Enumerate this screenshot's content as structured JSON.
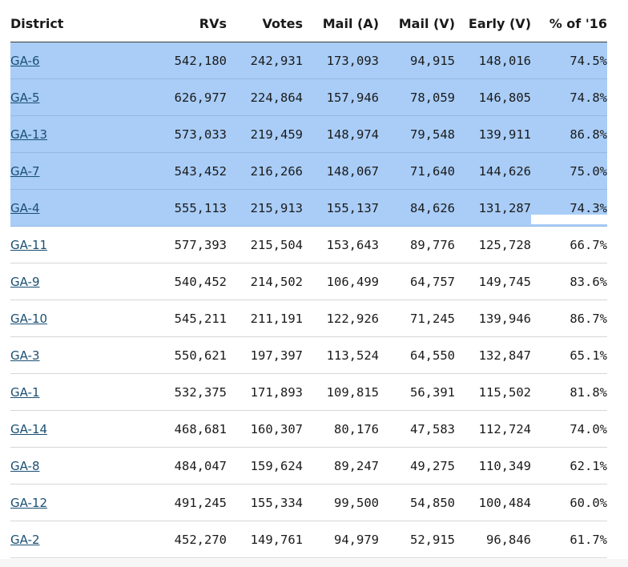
{
  "table": {
    "headers": {
      "district": "District",
      "rvs": "RVs",
      "votes": "Votes",
      "mail_a": "Mail (A)",
      "mail_v": "Mail (V)",
      "early_v": "Early (V)",
      "pct16": "% of '16"
    },
    "rows": [
      {
        "district": "GA-6",
        "rvs": "542,180",
        "votes": "242,931",
        "mail_a": "173,093",
        "mail_v": "94,915",
        "early_v": "148,016",
        "pct16": "74.5%",
        "selected": true
      },
      {
        "district": "GA-5",
        "rvs": "626,977",
        "votes": "224,864",
        "mail_a": "157,946",
        "mail_v": "78,059",
        "early_v": "146,805",
        "pct16": "74.8%",
        "selected": true
      },
      {
        "district": "GA-13",
        "rvs": "573,033",
        "votes": "219,459",
        "mail_a": "148,974",
        "mail_v": "79,548",
        "early_v": "139,911",
        "pct16": "86.8%",
        "selected": true
      },
      {
        "district": "GA-7",
        "rvs": "543,452",
        "votes": "216,266",
        "mail_a": "148,067",
        "mail_v": "71,640",
        "early_v": "144,626",
        "pct16": "75.0%",
        "selected": true
      },
      {
        "district": "GA-4",
        "rvs": "555,113",
        "votes": "215,913",
        "mail_a": "155,137",
        "mail_v": "84,626",
        "early_v": "131,287",
        "pct16": "74.3%",
        "selected": true
      },
      {
        "district": "GA-11",
        "rvs": "577,393",
        "votes": "215,504",
        "mail_a": "153,643",
        "mail_v": "89,776",
        "early_v": "125,728",
        "pct16": "66.7%",
        "selected": false
      },
      {
        "district": "GA-9",
        "rvs": "540,452",
        "votes": "214,502",
        "mail_a": "106,499",
        "mail_v": "64,757",
        "early_v": "149,745",
        "pct16": "83.6%",
        "selected": false
      },
      {
        "district": "GA-10",
        "rvs": "545,211",
        "votes": "211,191",
        "mail_a": "122,926",
        "mail_v": "71,245",
        "early_v": "139,946",
        "pct16": "86.7%",
        "selected": false
      },
      {
        "district": "GA-3",
        "rvs": "550,621",
        "votes": "197,397",
        "mail_a": "113,524",
        "mail_v": "64,550",
        "early_v": "132,847",
        "pct16": "65.1%",
        "selected": false
      },
      {
        "district": "GA-1",
        "rvs": "532,375",
        "votes": "171,893",
        "mail_a": "109,815",
        "mail_v": "56,391",
        "early_v": "115,502",
        "pct16": "81.8%",
        "selected": false
      },
      {
        "district": "GA-14",
        "rvs": "468,681",
        "votes": "160,307",
        "mail_a": "80,176",
        "mail_v": "47,583",
        "early_v": "112,724",
        "pct16": "74.0%",
        "selected": false
      },
      {
        "district": "GA-8",
        "rvs": "484,047",
        "votes": "159,624",
        "mail_a": "89,247",
        "mail_v": "49,275",
        "early_v": "110,349",
        "pct16": "62.1%",
        "selected": false
      },
      {
        "district": "GA-12",
        "rvs": "491,245",
        "votes": "155,334",
        "mail_a": "99,500",
        "mail_v": "54,850",
        "early_v": "100,484",
        "pct16": "60.0%",
        "selected": false
      },
      {
        "district": "GA-2",
        "rvs": "452,270",
        "votes": "149,761",
        "mail_a": "94,979",
        "mail_v": "52,915",
        "early_v": "96,846",
        "pct16": "61.7%",
        "selected": false
      }
    ]
  },
  "colors": {
    "selection": "#a9cdf7",
    "link": "#1b4f72"
  }
}
